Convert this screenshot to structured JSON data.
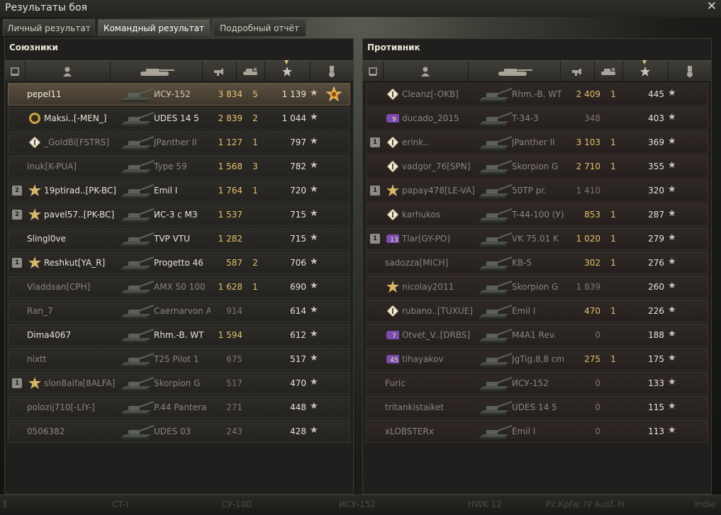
{
  "window": {
    "title": "Результаты боя",
    "close_glyph": "✕"
  },
  "tabs": [
    "Личный результат",
    "Командный результат",
    "Подробный отчёт"
  ],
  "active_tab": 1,
  "allies": {
    "title": "Союзники",
    "rows": [
      {
        "squad": "",
        "badge": "",
        "name": "pepel11",
        "vehicle": "ИСУ-152",
        "damage": "3 834",
        "kills": "5",
        "xp": "1 139",
        "medal": true,
        "state": "self"
      },
      {
        "squad": "",
        "badge": "skull",
        "name": "Maksi..[-MEN_]",
        "vehicle": "UDES 14 5",
        "damage": "2 839",
        "kills": "2",
        "xp": "1 044",
        "state": "alive"
      },
      {
        "squad": "",
        "badge": "diamond",
        "name": "_GoldBi[FSTRS]",
        "vehicle": "JPanther II",
        "damage": "1 127",
        "kills": "1",
        "xp": "797",
        "state": "dead"
      },
      {
        "squad": "",
        "badge": "",
        "name": "inuk[K-PUA]",
        "vehicle": "Type 59",
        "damage": "1 568",
        "kills": "3",
        "xp": "782",
        "state": "dead"
      },
      {
        "squad": "2",
        "badge": "star",
        "name": "19ptirad..[PK-BC]",
        "vehicle": "Emil I",
        "damage": "1 764",
        "kills": "1",
        "xp": "720",
        "state": "alive"
      },
      {
        "squad": "2",
        "badge": "star",
        "name": "pavel57..[PK-BC]",
        "vehicle": "ИС-3 с МЗ",
        "damage": "1 537",
        "kills": "",
        "xp": "715",
        "state": "alive"
      },
      {
        "squad": "",
        "badge": "",
        "name": "Slingl0ve",
        "vehicle": "TVP VTU",
        "damage": "1 282",
        "kills": "",
        "xp": "715",
        "state": "alive"
      },
      {
        "squad": "1",
        "badge": "star",
        "name": "Reshkut[YA_R]",
        "vehicle": "Progetto 46",
        "damage": "587",
        "kills": "2",
        "xp": "706",
        "state": "alive"
      },
      {
        "squad": "",
        "badge": "",
        "name": "Vladdsan[CPH]",
        "vehicle": "AMX 50 100",
        "damage": "1 628",
        "kills": "1",
        "xp": "690",
        "state": "dead"
      },
      {
        "squad": "",
        "badge": "",
        "name": "Ran_7",
        "vehicle": "Caernarvon A",
        "damage": "914",
        "kills": "",
        "xp": "614",
        "state": "dead"
      },
      {
        "squad": "",
        "badge": "",
        "name": "Dima4067",
        "vehicle": "Rhm.-B. WT",
        "damage": "1 594",
        "kills": "",
        "xp": "612",
        "state": "alive"
      },
      {
        "squad": "",
        "badge": "",
        "name": "nixtt",
        "vehicle": "T25 Pilot 1",
        "damage": "675",
        "kills": "",
        "xp": "517",
        "state": "dead"
      },
      {
        "squad": "1",
        "badge": "star",
        "name": "slon8alfa[8ALFA]",
        "vehicle": "Skorpion G",
        "damage": "517",
        "kills": "",
        "xp": "470",
        "state": "dead"
      },
      {
        "squad": "",
        "badge": "",
        "name": "polozij710[-LIY-]",
        "vehicle": "P.44 Pantera",
        "damage": "271",
        "kills": "",
        "xp": "448",
        "state": "dead"
      },
      {
        "squad": "",
        "badge": "",
        "name": "0506382",
        "vehicle": "UDES 03",
        "damage": "243",
        "kills": "",
        "xp": "428",
        "state": "dead"
      }
    ]
  },
  "enemies": {
    "title": "Противник",
    "rows": [
      {
        "squad": "",
        "badge": "diamond",
        "name": "Cleanz[-OKB]",
        "vehicle": "Rhm.-B. WT",
        "damage": "2 409",
        "kills": "1",
        "xp": "445",
        "state": "dead"
      },
      {
        "squad": "",
        "badge": "n9",
        "name": "ducado_2015",
        "vehicle": "T-34-3",
        "damage": "348",
        "kills": "",
        "xp": "403",
        "state": "dead"
      },
      {
        "squad": "1",
        "badge": "diamond",
        "name": "erink..",
        "vehicle": "JPanther II",
        "damage": "3 103",
        "kills": "1",
        "xp": "369",
        "state": "dead"
      },
      {
        "squad": "",
        "badge": "diamond",
        "name": "vadgor_76[SPN]",
        "vehicle": "Skorpion G",
        "damage": "2 710",
        "kills": "1",
        "xp": "355",
        "state": "dead"
      },
      {
        "squad": "1",
        "badge": "star",
        "name": "papay478[LE-VA]",
        "vehicle": "50TP pr.",
        "damage": "1 410",
        "kills": "",
        "xp": "320",
        "state": "dead"
      },
      {
        "squad": "",
        "badge": "diamond",
        "name": "karhukos",
        "vehicle": "T-44-100 (У)",
        "damage": "853",
        "kills": "1",
        "xp": "287",
        "state": "dead"
      },
      {
        "squad": "1",
        "badge": "n13",
        "name": "Tlar[GY-PO]",
        "vehicle": "VK 75.01 K",
        "damage": "1 020",
        "kills": "1",
        "xp": "279",
        "state": "dead"
      },
      {
        "squad": "",
        "badge": "",
        "name": "sadozza[MICH]",
        "vehicle": "KB-5",
        "damage": "302",
        "kills": "1",
        "xp": "276",
        "state": "dead"
      },
      {
        "squad": "",
        "badge": "star",
        "name": "nicolay2011",
        "vehicle": "Skorpion G",
        "damage": "1 839",
        "kills": "",
        "xp": "260",
        "state": "dead"
      },
      {
        "squad": "",
        "badge": "diamond",
        "name": "rubano..[TUXUE]",
        "vehicle": "Emil I",
        "damage": "470",
        "kills": "1",
        "xp": "226",
        "state": "dead"
      },
      {
        "squad": "",
        "badge": "n7",
        "name": "Otvet_V..[DRBS]",
        "vehicle": "M4A1 Rev.",
        "damage": "0",
        "kills": "",
        "xp": "188",
        "state": "dead"
      },
      {
        "squad": "",
        "badge": "n45",
        "name": "tihayakov",
        "vehicle": "JgTig.8,8 cm",
        "damage": "275",
        "kills": "1",
        "xp": "175",
        "state": "dead"
      },
      {
        "squad": "",
        "badge": "",
        "name": "Furic",
        "vehicle": "ИСУ-152",
        "damage": "0",
        "kills": "",
        "xp": "133",
        "state": "dead"
      },
      {
        "squad": "",
        "badge": "",
        "name": "tritankistaiket",
        "vehicle": "UDES 14 5",
        "damage": "0",
        "kills": "",
        "xp": "115",
        "state": "dead"
      },
      {
        "squad": "",
        "badge": "",
        "name": "xLOBSTERx",
        "vehicle": "Emil I",
        "damage": "0",
        "kills": "",
        "xp": "113",
        "state": "dead"
      }
    ]
  },
  "bottom_bar": [
    "3",
    "СТ-I",
    "СУ-100",
    "ИСУ-152",
    "HWK 12",
    "Pz.Kpfw. IV Ausf. H",
    "Indie"
  ],
  "colors": {
    "damage": "#e7c06b",
    "self_row": "#5a4f3f",
    "enemy_row": "#2f2826"
  },
  "icons": {
    "xp": "star-icon",
    "sort": "sort-arrow-icon"
  }
}
